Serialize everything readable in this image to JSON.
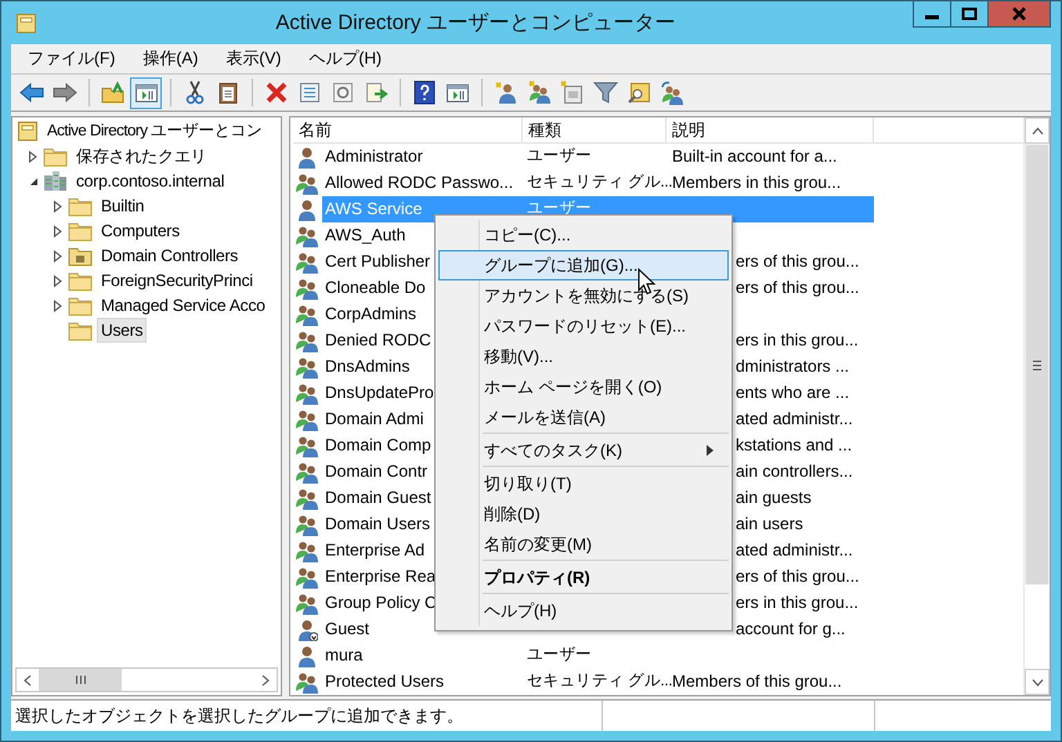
{
  "window": {
    "title": "Active Directory ユーザーとコンピューター"
  },
  "menu_bar": [
    "ファイル(F)",
    "操作(A)",
    "表示(V)",
    "ヘルプ(H)"
  ],
  "toolbar": [
    [
      {
        "kind": "back",
        "pressed": false
      },
      {
        "kind": "forward",
        "pressed": false
      }
    ],
    [
      {
        "kind": "up",
        "pressed": false
      },
      {
        "kind": "tree-pane",
        "pressed": true
      }
    ],
    [
      {
        "kind": "cut",
        "pressed": false
      },
      {
        "kind": "paste",
        "pressed": false
      }
    ],
    [
      {
        "kind": "delete",
        "pressed": false
      },
      {
        "kind": "properties",
        "pressed": false
      },
      {
        "kind": "refresh",
        "pressed": false
      },
      {
        "kind": "export",
        "pressed": false
      }
    ],
    [
      {
        "kind": "help",
        "pressed": false
      },
      {
        "kind": "action-pane",
        "pressed": false
      }
    ],
    [
      {
        "kind": "new-user",
        "pressed": false
      },
      {
        "kind": "new-group",
        "pressed": false
      },
      {
        "kind": "new-ou",
        "pressed": false
      },
      {
        "kind": "filter",
        "pressed": false
      },
      {
        "kind": "find",
        "pressed": false
      },
      {
        "kind": "add-group",
        "pressed": false
      }
    ]
  ],
  "tree": [
    {
      "label": "Active Directory ユーザーとコン",
      "kind": "root",
      "selected": false,
      "children": [
        {
          "label": "保存されたクエリ",
          "kind": "folder",
          "expanded": false,
          "selected": false
        },
        {
          "label": "corp.contoso.internal",
          "kind": "domain",
          "expanded": true,
          "selected": false,
          "children": [
            {
              "label": "Builtin",
              "kind": "folder",
              "expanded": false,
              "selected": false
            },
            {
              "label": "Computers",
              "kind": "folder",
              "expanded": false,
              "selected": false
            },
            {
              "label": "Domain Controllers",
              "kind": "ou",
              "expanded": false,
              "selected": false
            },
            {
              "label": "ForeignSecurityPrinci",
              "kind": "folder",
              "expanded": false,
              "selected": false
            },
            {
              "label": "Managed Service Acco",
              "kind": "folder",
              "expanded": false,
              "selected": false
            },
            {
              "label": "Users",
              "kind": "folder",
              "selected": true
            }
          ]
        }
      ]
    }
  ],
  "table": {
    "columns": [
      "名前",
      "種類",
      "説明"
    ],
    "rows": [
      {
        "kind": "user",
        "name": "Administrator",
        "type": "ユーザー",
        "description": "Built-in account for a...",
        "selected": false
      },
      {
        "kind": "group",
        "name": "Allowed RODC Passwo...",
        "type": "セキュリティ グル...",
        "description": "Members in this grou...",
        "selected": false
      },
      {
        "kind": "user",
        "name": "AWS Service",
        "type": "ユーザー",
        "selected": true
      },
      {
        "kind": "group",
        "name": "AWS_Auth",
        "selected": false
      },
      {
        "kind": "group",
        "name": "Cert Publisher",
        "description": "ers of this grou...",
        "selected": false
      },
      {
        "kind": "group",
        "name": "Cloneable Do",
        "description": "ers of this grou...",
        "selected": false
      },
      {
        "kind": "group",
        "name": "CorpAdmins",
        "selected": false
      },
      {
        "kind": "group",
        "name": "Denied RODC",
        "description": "ers in this grou...",
        "selected": false
      },
      {
        "kind": "group",
        "name": "DnsAdmins",
        "description": "dministrators ...",
        "selected": false
      },
      {
        "kind": "group",
        "name": "DnsUpdatePro",
        "description": "ents who are ...",
        "selected": false
      },
      {
        "kind": "group",
        "name": "Domain Admi",
        "description": "ated administr...",
        "selected": false
      },
      {
        "kind": "group",
        "name": "Domain Comp",
        "description": "kstations and ...",
        "selected": false
      },
      {
        "kind": "group",
        "name": "Domain Contr",
        "description": "ain controllers...",
        "selected": false
      },
      {
        "kind": "group",
        "name": "Domain Guest",
        "description": "ain guests",
        "selected": false
      },
      {
        "kind": "group",
        "name": "Domain Users",
        "description": "ain users",
        "selected": false
      },
      {
        "kind": "group",
        "name": "Enterprise Ad",
        "description": "ated administr...",
        "selected": false
      },
      {
        "kind": "group",
        "name": "Enterprise Rea",
        "description": "ers of this grou...",
        "selected": false
      },
      {
        "kind": "group",
        "name": "Group Policy C",
        "description": "ers in this grou...",
        "selected": false
      },
      {
        "kind": "disabled-user",
        "name": "Guest",
        "description": "account for g...",
        "selected": false
      },
      {
        "kind": "user",
        "name": "mura",
        "type": "ユーザー",
        "selected": false
      },
      {
        "kind": "group",
        "name": "Protected Users",
        "type": "セキュリティ グル...",
        "description": "Members of this grou...",
        "selected": false
      }
    ]
  },
  "context_menu": [
    {
      "kind": "item",
      "label": "コピー(C)...",
      "selected": false
    },
    {
      "kind": "item",
      "label": "グループに追加(G)...",
      "selected": true
    },
    {
      "kind": "item",
      "label": "アカウントを無効にする(S)",
      "selected": false
    },
    {
      "kind": "item",
      "label": "パスワードのリセット(E)...",
      "selected": false
    },
    {
      "kind": "item",
      "label": "移動(V)...",
      "selected": false
    },
    {
      "kind": "item",
      "label": "ホーム ページを開く(O)",
      "selected": false
    },
    {
      "kind": "item",
      "label": "メールを送信(A)",
      "selected": false
    },
    {
      "kind": "separator"
    },
    {
      "kind": "submenu",
      "label": "すべてのタスク(K)",
      "selected": false
    },
    {
      "kind": "separator"
    },
    {
      "kind": "item",
      "label": "切り取り(T)",
      "selected": false
    },
    {
      "kind": "item",
      "label": "削除(D)",
      "selected": false
    },
    {
      "kind": "item",
      "label": "名前の変更(M)",
      "selected": false
    },
    {
      "kind": "separator"
    },
    {
      "kind": "default",
      "label": "プロパティ(R)",
      "selected": false
    },
    {
      "kind": "separator"
    },
    {
      "kind": "item",
      "label": "ヘルプ(H)",
      "selected": false
    }
  ],
  "status_bar": "選択したオブジェクトを選択したグループに追加できます。"
}
